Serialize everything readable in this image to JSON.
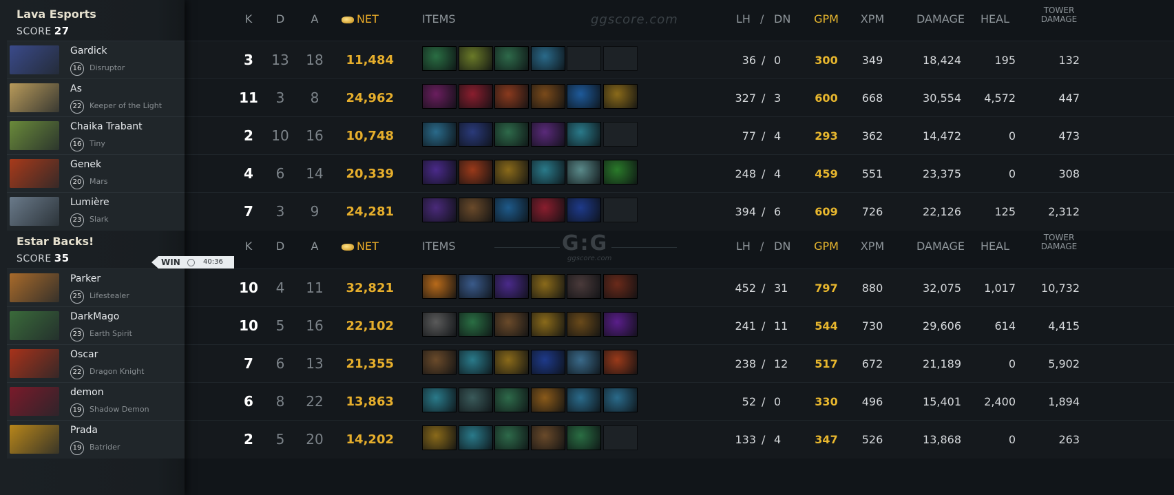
{
  "teams": [
    {
      "name": "Lava Esports",
      "score_label": "SCORE",
      "score": "27",
      "players": [
        {
          "name": "Gardick",
          "level": "16",
          "hero": "Disruptor",
          "k": "3",
          "d": "13",
          "a": "18",
          "net": "11,484",
          "lh": "36",
          "dn": "0",
          "gpm": "300",
          "xpm": "349",
          "damage": "18,424",
          "heal": "195",
          "tower": "132",
          "items": [
            "#2a6e43",
            "#6a7a28",
            "#2e6a4a",
            "#2a6a8a",
            null,
            null
          ]
        },
        {
          "name": "As",
          "level": "22",
          "hero": "Keeper of the Light",
          "k": "11",
          "d": "3",
          "a": "8",
          "net": "24,962",
          "lh": "327",
          "dn": "3",
          "gpm": "600",
          "xpm": "668",
          "damage": "30,554",
          "heal": "4,572",
          "tower": "447",
          "items": [
            "#6a1e5e",
            "#8a1e2e",
            "#8a3a1e",
            "#7a4a1a",
            "#1e5a9a",
            "#8a6a1a"
          ]
        },
        {
          "name": "Chaika Trabant",
          "level": "16",
          "hero": "Tiny",
          "k": "2",
          "d": "10",
          "a": "16",
          "net": "10,748",
          "lh": "77",
          "dn": "4",
          "gpm": "293",
          "xpm": "362",
          "damage": "14,472",
          "heal": "0",
          "tower": "473",
          "items": [
            "#2a6a8a",
            "#2a3a7a",
            "#2e6a4a",
            "#5a2a7a",
            "#2a7a8a",
            null
          ]
        },
        {
          "name": "Genek",
          "level": "20",
          "hero": "Mars",
          "k": "4",
          "d": "6",
          "a": "14",
          "net": "20,339",
          "lh": "248",
          "dn": "4",
          "gpm": "459",
          "xpm": "551",
          "damage": "23,375",
          "heal": "0",
          "tower": "308",
          "items": [
            "#4a2a8a",
            "#9a3a1a",
            "#8a6a1a",
            "#2a7a8a",
            "#5a8a8a",
            "#2a7a2a"
          ]
        },
        {
          "name": "Lumière",
          "level": "23",
          "hero": "Slark",
          "k": "7",
          "d": "3",
          "a": "9",
          "net": "24,281",
          "lh": "394",
          "dn": "6",
          "gpm": "609",
          "xpm": "726",
          "damage": "22,126",
          "heal": "125",
          "tower": "2,312",
          "items": [
            "#4a2a7a",
            "#6a4a2a",
            "#1e5a8a",
            "#8a1e2e",
            "#1e3a8a",
            null
          ]
        }
      ]
    },
    {
      "name": "Estar Backs!",
      "score_label": "SCORE",
      "score": "35",
      "players": [
        {
          "name": "Parker",
          "level": "25",
          "hero": "Lifestealer",
          "k": "10",
          "d": "4",
          "a": "11",
          "net": "32,821",
          "lh": "452",
          "dn": "31",
          "gpm": "797",
          "xpm": "880",
          "damage": "32,075",
          "heal": "1,017",
          "tower": "10,732",
          "items": [
            "#b86a1a",
            "#3a5a8a",
            "#4a2a8a",
            "#8a6a1a",
            "#4a3a3a",
            "#6a2a1a"
          ]
        },
        {
          "name": "DarkMago",
          "level": "23",
          "hero": "Earth Spirit",
          "k": "10",
          "d": "5",
          "a": "16",
          "net": "22,102",
          "lh": "241",
          "dn": "11",
          "gpm": "544",
          "xpm": "730",
          "damage": "29,606",
          "heal": "614",
          "tower": "4,415",
          "items": [
            "#5a5a5a",
            "#2a6e43",
            "#6a4a2a",
            "#8a6a1a",
            "#6a4a1a",
            "#5a1e8a"
          ]
        },
        {
          "name": "Oscar",
          "level": "22",
          "hero": "Dragon Knight",
          "k": "7",
          "d": "6",
          "a": "13",
          "net": "21,355",
          "lh": "238",
          "dn": "12",
          "gpm": "517",
          "xpm": "672",
          "damage": "21,189",
          "heal": "0",
          "tower": "5,902",
          "items": [
            "#6a4a2a",
            "#2a7a8a",
            "#8a6a1a",
            "#1e3a8a",
            "#3a6a8a",
            "#9a3a1a"
          ]
        },
        {
          "name": "demon",
          "level": "19",
          "hero": "Shadow Demon",
          "k": "6",
          "d": "8",
          "a": "22",
          "net": "13,863",
          "lh": "52",
          "dn": "0",
          "gpm": "330",
          "xpm": "496",
          "damage": "15,401",
          "heal": "2,400",
          "tower": "1,894",
          "items": [
            "#2a7a8a",
            "#3a5a5a",
            "#2e6a4a",
            "#8a5a1a",
            "#2a6a8a",
            "#2a6a8a"
          ]
        },
        {
          "name": "Prada",
          "level": "19",
          "hero": "Batrider",
          "k": "2",
          "d": "5",
          "a": "20",
          "net": "14,202",
          "lh": "133",
          "dn": "4",
          "gpm": "347",
          "xpm": "526",
          "damage": "13,868",
          "heal": "0",
          "tower": "263",
          "items": [
            "#8a6a1a",
            "#2a7a8a",
            "#2e6a4a",
            "#6a4a2a",
            "#2a6e43",
            null
          ]
        }
      ]
    }
  ],
  "winner_badge": {
    "label": "WIN",
    "time": "40:36"
  },
  "headers": {
    "k": "K",
    "d": "D",
    "a": "A",
    "net": "NET",
    "items": "ITEMS",
    "lh": "LH",
    "slash": "/",
    "dn": "DN",
    "gpm": "GPM",
    "xpm": "XPM",
    "damage": "DAMAGE",
    "heal": "HEAL",
    "tower_line1": "TOWER",
    "tower_line2": "DAMAGE"
  },
  "watermark": {
    "site": "ggscore.com",
    "logo": "G:G",
    "logo_sub": "ggscore.com"
  },
  "colors": {
    "gold": "#e6ae2c",
    "gpm": "#e8b72e",
    "panel": "#1b2024",
    "row": "#15191d"
  },
  "portraits": [
    "#3a4a8a",
    "#b89a5a",
    "#6a8a3a",
    "#a83a1a",
    "#6a7a8a",
    "#a86a2a",
    "#3a6a3a",
    "#a8321a",
    "#7a1a2a",
    "#b8861a"
  ]
}
